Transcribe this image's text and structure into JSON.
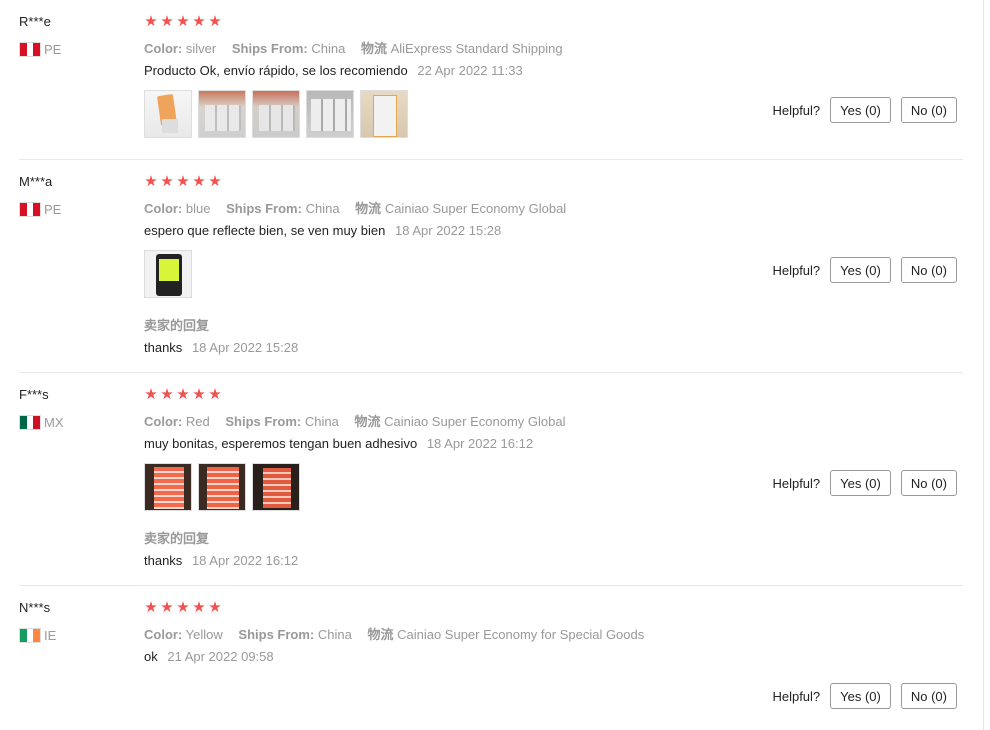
{
  "reviews": [
    {
      "user": "R***e",
      "country": "PE",
      "flag_colors": [
        "#d91023",
        "#ffffff",
        "#d91023"
      ],
      "stars": [
        "★",
        "★",
        "★",
        "★",
        "★"
      ],
      "color_label": "Color:",
      "color": "silver",
      "ships_label": "Ships From:",
      "ships": "China",
      "logistics_label": "物流",
      "logistics": "AliExpress Standard Shipping",
      "text": "Producto Ok, envío rápido, se los recomiendo",
      "date": "22 Apr 2022 11:33",
      "thumbs": [
        "photo",
        "photo",
        "photo",
        "photo",
        "photo"
      ],
      "helpful_label": "Helpful?",
      "yes": "Yes (0)",
      "no": "No (0)"
    },
    {
      "user": "M***a",
      "country": "PE",
      "flag_colors": [
        "#d91023",
        "#ffffff",
        "#d91023"
      ],
      "stars": [
        "★",
        "★",
        "★",
        "★",
        "★"
      ],
      "color_label": "Color:",
      "color": "blue",
      "ships_label": "Ships From:",
      "ships": "China",
      "logistics_label": "物流",
      "logistics": "Cainiao Super Economy Global",
      "text": "espero que reflecte bien, se ven muy bien",
      "date": "18 Apr 2022 15:28",
      "thumbs": [
        "photo"
      ],
      "reply_title": "卖家的回复",
      "reply_text": "thanks",
      "reply_date": "18 Apr 2022 15:28",
      "helpful_label": "Helpful?",
      "yes": "Yes (0)",
      "no": "No (0)"
    },
    {
      "user": "F***s",
      "country": "MX",
      "flag_colors": [
        "#006847",
        "#ffffff",
        "#ce1126"
      ],
      "stars": [
        "★",
        "★",
        "★",
        "★",
        "★"
      ],
      "color_label": "Color:",
      "color": "Red",
      "ships_label": "Ships From:",
      "ships": "China",
      "logistics_label": "物流",
      "logistics": "Cainiao Super Economy Global",
      "text": "muy bonitas, esperemos tengan buen adhesivo",
      "date": "18 Apr 2022 16:12",
      "thumbs": [
        "photo",
        "photo",
        "photo"
      ],
      "reply_title": "卖家的回复",
      "reply_text": "thanks",
      "reply_date": "18 Apr 2022 16:12",
      "helpful_label": "Helpful?",
      "yes": "Yes (0)",
      "no": "No (0)"
    },
    {
      "user": "N***s",
      "country": "IE",
      "flag_colors": [
        "#169b62",
        "#ffffff",
        "#ff883e"
      ],
      "stars": [
        "★",
        "★",
        "★",
        "★",
        "★"
      ],
      "color_label": "Color:",
      "color": "Yellow",
      "ships_label": "Ships From:",
      "ships": "China",
      "logistics_label": "物流",
      "logistics": "Cainiao Super Economy for Special Goods",
      "text": "ok",
      "date": "21 Apr 2022 09:58",
      "helpful_label": "Helpful?",
      "yes": "Yes (0)",
      "no": "No (0)"
    }
  ]
}
